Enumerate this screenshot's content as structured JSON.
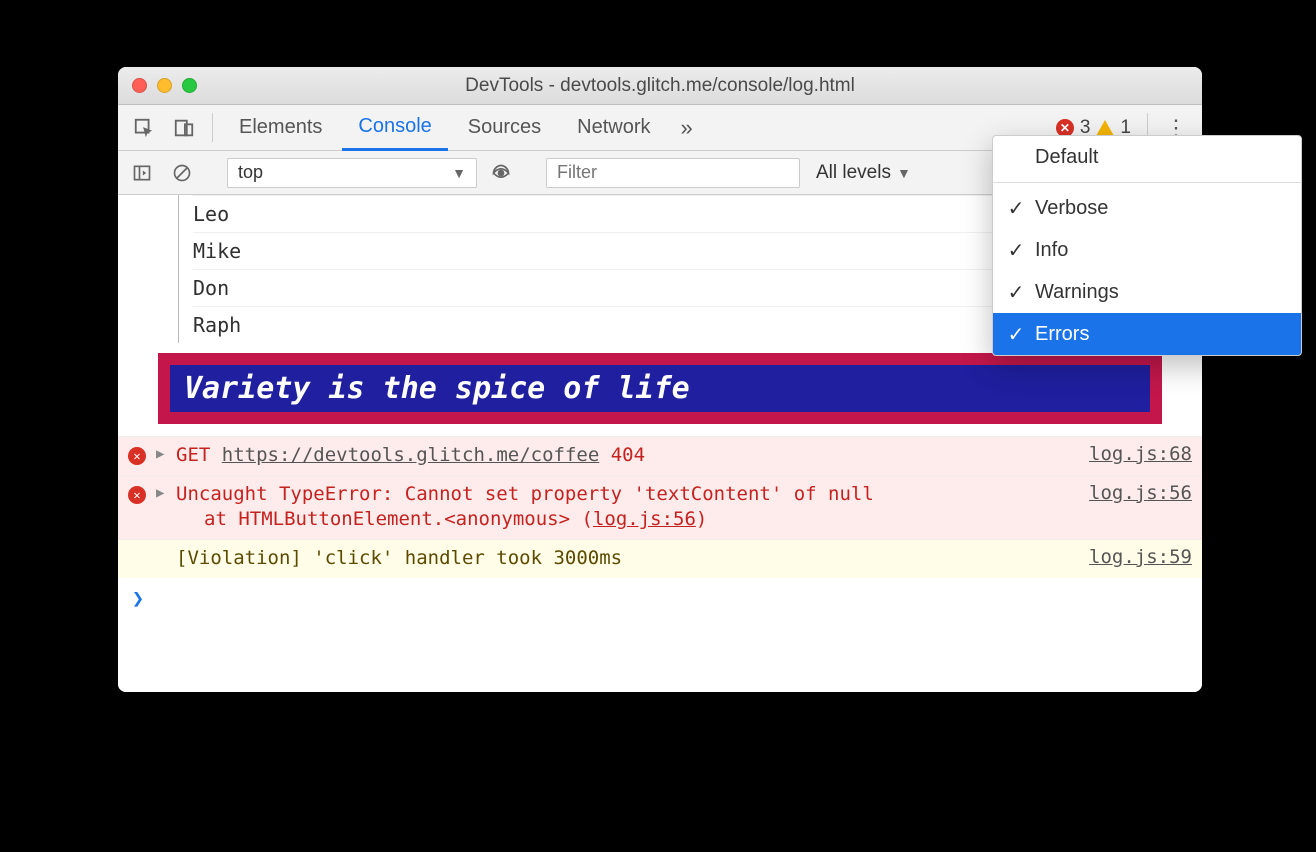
{
  "window": {
    "title": "DevTools - devtools.glitch.me/console/log.html"
  },
  "tabs": {
    "items": [
      "Elements",
      "Console",
      "Sources",
      "Network"
    ],
    "active_index": 1,
    "error_count": "3",
    "warning_count": "1"
  },
  "toolbar": {
    "context": "top",
    "filter_placeholder": "Filter",
    "levels_label": "All levels"
  },
  "dropdown": {
    "default_label": "Default",
    "options": [
      {
        "label": "Verbose",
        "checked": true,
        "selected": false
      },
      {
        "label": "Info",
        "checked": true,
        "selected": false
      },
      {
        "label": "Warnings",
        "checked": true,
        "selected": false
      },
      {
        "label": "Errors",
        "checked": true,
        "selected": true
      }
    ]
  },
  "console": {
    "tree": [
      "Leo",
      "Mike",
      "Don",
      "Raph"
    ],
    "styled_message": "Variety is the spice of life",
    "rows": [
      {
        "type": "error",
        "method": "GET",
        "url": "https://devtools.glitch.me/coffee",
        "status": "404",
        "source": "log.js:68"
      },
      {
        "type": "error",
        "text": "Uncaught TypeError: Cannot set property 'textContent' of null",
        "stack_prefix": "at HTMLButtonElement.<anonymous> (",
        "stack_link": "log.js:56",
        "stack_suffix": ")",
        "source": "log.js:56"
      },
      {
        "type": "violation",
        "text": "[Violation] 'click' handler took 3000ms",
        "source": "log.js:59"
      }
    ]
  }
}
